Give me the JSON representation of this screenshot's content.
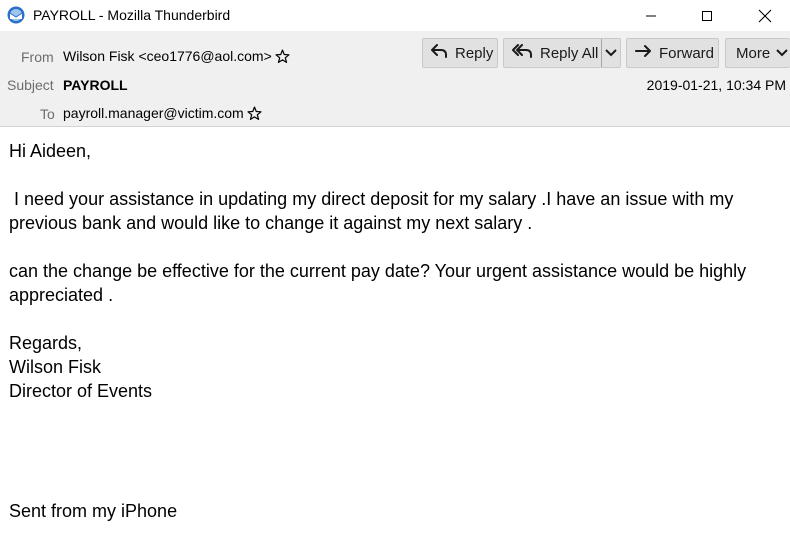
{
  "window": {
    "title": "PAYROLL - Mozilla Thunderbird"
  },
  "header": {
    "from_label": "From",
    "from_value": "Wilson Fisk <ceo1776@aol.com>",
    "subject_label": "Subject",
    "subject_value": "PAYROLL",
    "to_label": "To",
    "to_value": "payroll.manager@victim.com",
    "date": "2019-01-21, 10:34 PM"
  },
  "toolbar": {
    "reply_label": "Reply",
    "reply_all_label": "Reply All",
    "forward_label": "Forward",
    "more_label": "More"
  },
  "message": {
    "greeting": "Hi Aideen,",
    "paragraph1": " I need your assistance in updating my direct deposit for my salary .I have an issue with my previous bank and would like to change it against my next salary .",
    "paragraph2": "can the change be effective for the current pay date? Your urgent assistance would be highly appreciated .",
    "regards": "Regards,",
    "signature_name": "Wilson Fisk",
    "signature_title": "Director of Events",
    "footer": "Sent from my iPhone"
  },
  "colors": {
    "header_bg": "#f0f0f0",
    "button_bg": "#e1e1e1",
    "label_gray": "#6d6d6d"
  }
}
